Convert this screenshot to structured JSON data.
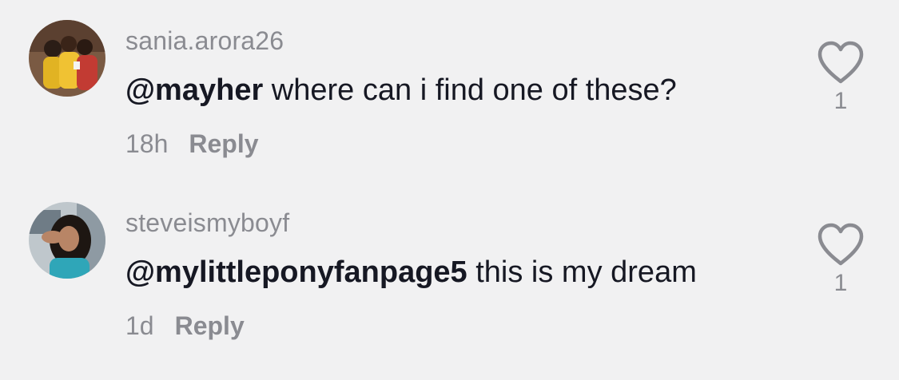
{
  "comments": [
    {
      "username": "sania.arora26",
      "mention": "@mayher",
      "text": " where can i find one of these?",
      "time": "18h",
      "reply_label": "Reply",
      "likes": "1"
    },
    {
      "username": "steveismyboyf",
      "mention": "@mylittleponyfanpage5",
      "text": " this is my dream",
      "time": "1d",
      "reply_label": "Reply",
      "likes": "1"
    }
  ],
  "colors": {
    "background": "#f1f1f2",
    "primary_text": "#161823",
    "secondary_text": "#8a8b91"
  },
  "icons": {
    "like": "heart-outline-icon"
  }
}
